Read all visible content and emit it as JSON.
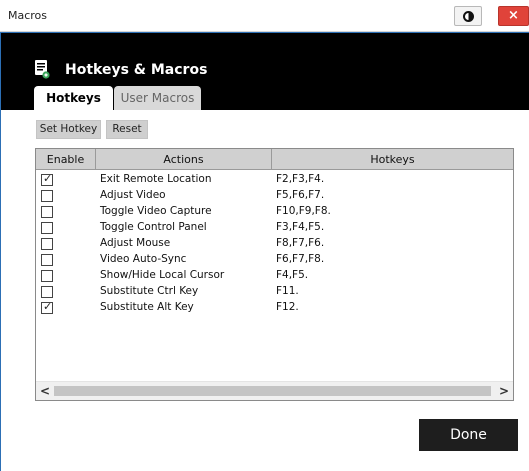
{
  "window": {
    "title": "Macros",
    "close_glyph": "×",
    "accent_color": "#2c6fb5"
  },
  "header": {
    "title": "Hotkeys & Macros",
    "icon": "macro-document-icon"
  },
  "tabs": [
    {
      "label": "Hotkeys",
      "active": true
    },
    {
      "label": "User Macros",
      "active": false
    }
  ],
  "toolbar": {
    "set_hotkey_label": "Set Hotkey",
    "reset_label": "Reset"
  },
  "table": {
    "columns": [
      "Enable",
      "Actions",
      "Hotkeys"
    ],
    "rows": [
      {
        "enabled": true,
        "action": "Exit Remote Location",
        "hotkeys": "F2,F3,F4."
      },
      {
        "enabled": false,
        "action": "Adjust Video",
        "hotkeys": "F5,F6,F7."
      },
      {
        "enabled": false,
        "action": "Toggle Video Capture",
        "hotkeys": "F10,F9,F8."
      },
      {
        "enabled": false,
        "action": "Toggle Control Panel",
        "hotkeys": "F3,F4,F5."
      },
      {
        "enabled": false,
        "action": "Adjust Mouse",
        "hotkeys": "F8,F7,F6."
      },
      {
        "enabled": false,
        "action": "Video Auto-Sync",
        "hotkeys": "F6,F7,F8."
      },
      {
        "enabled": false,
        "action": "Show/Hide Local Cursor",
        "hotkeys": "F4,F5."
      },
      {
        "enabled": false,
        "action": "Substitute Ctrl Key",
        "hotkeys": "F11."
      },
      {
        "enabled": true,
        "action": "Substitute Alt Key",
        "hotkeys": "F12."
      }
    ]
  },
  "scrollbar": {
    "left_glyph": "<",
    "right_glyph": ">"
  },
  "footer": {
    "done_label": "Done"
  }
}
